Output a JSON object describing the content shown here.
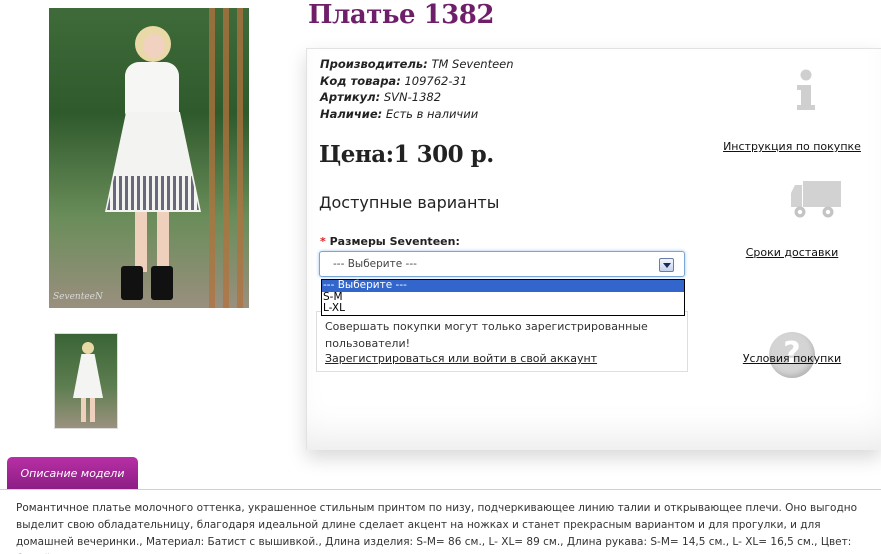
{
  "product": {
    "title": "Платье 1382",
    "photo_signature": "SeventeeN",
    "meta": [
      {
        "label": "Производитель:",
        "value": "TM Seventeen"
      },
      {
        "label": "Код товара:",
        "value": "109762-31"
      },
      {
        "label": "Артикул:",
        "value": "SVN-1382"
      },
      {
        "label": "Наличие:",
        "value": "Есть в наличии"
      }
    ],
    "price": "Цена:1 300 р.",
    "variants_title": "Доступные варианты",
    "size_label": "Размеры Seventeen:",
    "required_mark": "*",
    "size_select": {
      "value": "--- Выберите ---",
      "options": [
        "--- Выберите ---",
        "S-M",
        "L-XL"
      ]
    },
    "login_notice": "Совершать покупки могут только зарегистрированные пользователи!",
    "login_link": "Зарегистрироваться или войти в свой аккаунт"
  },
  "side_links": {
    "instruction": "Инструкция по покупке",
    "delivery": "Сроки доставки",
    "conditions": "Условия покупки"
  },
  "description": {
    "tab_label": "Описание модели",
    "text": "Романтичное платье молочного оттенка, украшенное стильным принтом по низу, подчеркивающее линию талии и открывающее плечи. Оно выгодно выделит свою обладательницу, благодаря идеальной длине сделает акцент на ножках и станет прекрасным вариантом и для прогулки, и для домашней вечеринки., Материал: Батист с вышивкой., Длина изделия: S-M= 86 см., L- XL= 89 см., Длина рукава: S-M= 14,5 см., L- XL= 16,5 см., Цвет: белый."
  },
  "colors": {
    "accent_purple": "#6f1f6a",
    "tab_purple": "#a0258f",
    "select_highlight": "#3366cc"
  }
}
